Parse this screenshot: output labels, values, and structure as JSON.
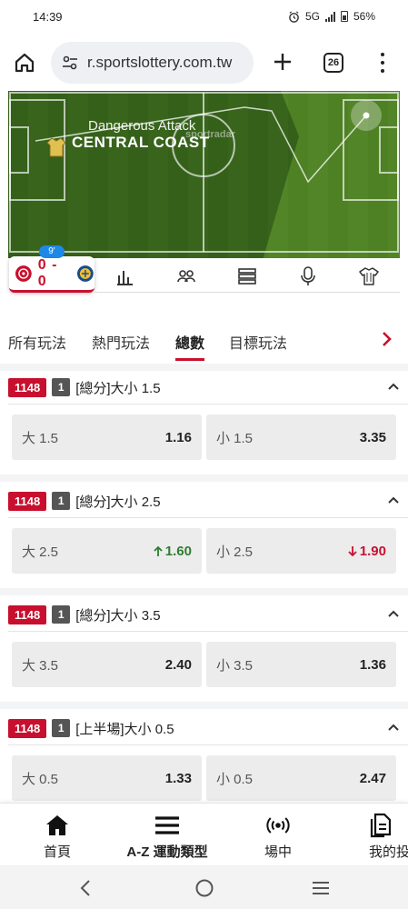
{
  "status": {
    "time": "14:39",
    "network": "5G",
    "battery": "56%"
  },
  "browser": {
    "url": "r.sportslottery.com.tw",
    "tab_count": "26"
  },
  "pitch": {
    "event": "Dangerous Attack",
    "team": "CENTRAL COAST",
    "watermark": "sportradar",
    "colors": {
      "grass_dark": "#3d6e1c",
      "grass_light": "#5a8e2a",
      "lines": "#ffffff"
    }
  },
  "scoreboard": {
    "minute": "9'",
    "score": "0 - 0",
    "stat_tabs": [
      "chart-icon",
      "lineup-icon",
      "table-icon",
      "commentary-icon",
      "kit-icon"
    ]
  },
  "market_tabs": {
    "items": [
      "所有玩法",
      "熱門玩法",
      "總數",
      "目標玩法"
    ],
    "active": "總數"
  },
  "markets": [
    {
      "id": "1148",
      "count": "1",
      "title": "[總分]大小 1.5",
      "over_label": "大 1.5",
      "over_odds": "1.16",
      "over_trend": "",
      "under_label": "小 1.5",
      "under_odds": "3.35",
      "under_trend": ""
    },
    {
      "id": "1148",
      "count": "1",
      "title": "[總分]大小 2.5",
      "over_label": "大 2.5",
      "over_odds": "1.60",
      "over_trend": "up",
      "under_label": "小 2.5",
      "under_odds": "1.90",
      "under_trend": "down"
    },
    {
      "id": "1148",
      "count": "1",
      "title": "[總分]大小 3.5",
      "over_label": "大 3.5",
      "over_odds": "2.40",
      "over_trend": "",
      "under_label": "小 3.5",
      "under_odds": "1.36",
      "under_trend": ""
    },
    {
      "id": "1148",
      "count": "1",
      "title": "[上半場]大小 0.5",
      "over_label": "大 0.5",
      "over_odds": "1.33",
      "over_trend": "",
      "under_label": "小 0.5",
      "under_odds": "2.47",
      "under_trend": ""
    }
  ],
  "bottom_nav": {
    "home": "首頁",
    "az": "A-Z 運動類型",
    "live": "場中",
    "mybets": "我的投注"
  },
  "colors": {
    "brand_red": "#c8102e",
    "odds_up": "#2e7d32",
    "odds_down": "#c8102e"
  }
}
